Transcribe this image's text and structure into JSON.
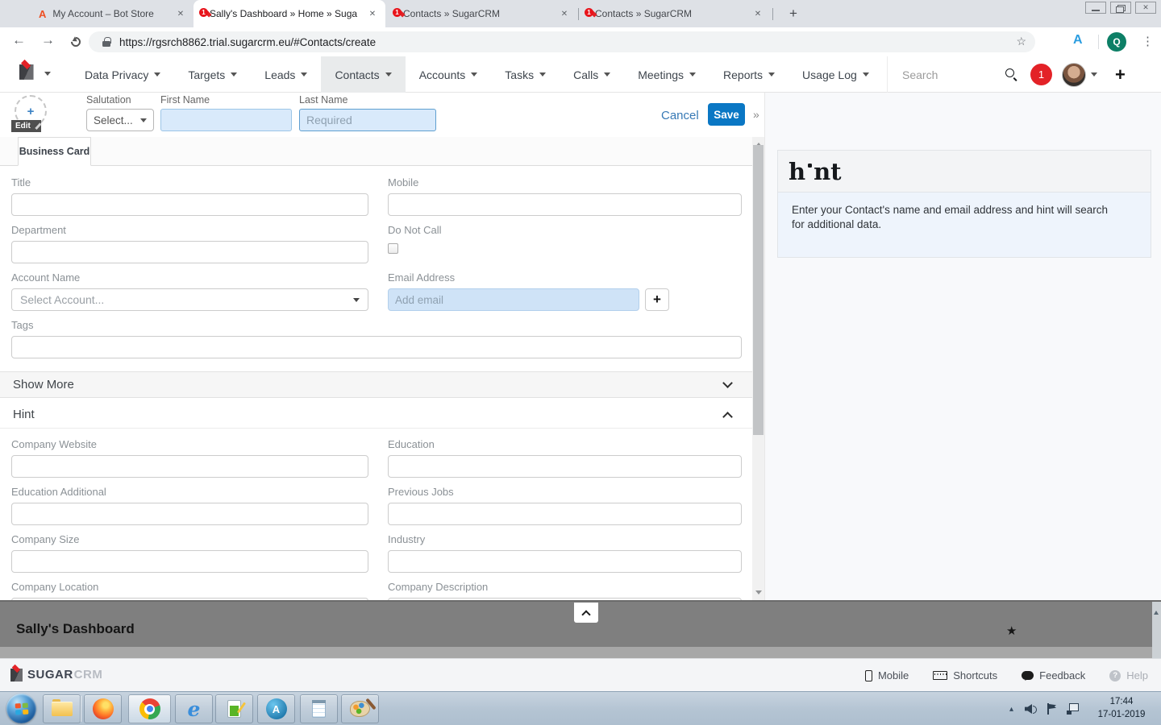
{
  "browser": {
    "tabs": [
      {
        "title": "My Account – Bot Store",
        "favicon": "automation-anywhere",
        "favicon_letter": "A"
      },
      {
        "title": "Sally's Dashboard » Home » Suga",
        "favicon": "sugarcrm"
      },
      {
        "title": "Contacts » SugarCRM",
        "favicon": "sugarcrm"
      },
      {
        "title": "Contacts » SugarCRM",
        "favicon": "sugarcrm"
      }
    ],
    "favicon_badge": "1",
    "url": "https://rgsrch8862.trial.sugarcrm.eu/#Contacts/create",
    "extension_letter": "A",
    "profile_initial": "Q"
  },
  "icons": {
    "close": "✕",
    "new_tab": "+",
    "back": "←",
    "forward": "→",
    "star_outline": "☆",
    "star_filled": "★",
    "menu_dots": "⋮",
    "overflow_chevrons": "»",
    "plus": "+",
    "question": "?",
    "tray_arrow": "▴",
    "ie_letter": "e",
    "aa_letter": "A"
  },
  "navbar": {
    "menu": [
      "Data Privacy",
      "Targets",
      "Leads",
      "Contacts",
      "Accounts",
      "Tasks",
      "Calls",
      "Meetings",
      "Reports",
      "Usage Log"
    ],
    "active_item": "Contacts",
    "search_placeholder": "Search",
    "notification_count": "1"
  },
  "record_header": {
    "edit_label": "Edit",
    "salutation_label": "Salutation",
    "salutation_value": "Select...",
    "first_name_label": "First Name",
    "last_name_label": "Last Name",
    "last_name_placeholder": "Required",
    "cancel_label": "Cancel",
    "save_label": "Save"
  },
  "form": {
    "tab_label": "Business Card",
    "title_label": "Title",
    "mobile_label": "Mobile",
    "department_label": "Department",
    "do_not_call_label": "Do Not Call",
    "account_name_label": "Account Name",
    "account_name_placeholder": "Select Account...",
    "email_label": "Email Address",
    "email_placeholder": "Add email",
    "email_add_button": "+",
    "tags_label": "Tags",
    "show_more_label": "Show More",
    "hint_section_label": "Hint",
    "hint_fields": {
      "company_website": "Company Website",
      "education": "Education",
      "education_additional": "Education Additional",
      "previous_jobs": "Previous Jobs",
      "company_size": "Company Size",
      "industry": "Industry",
      "company_location": "Company Location",
      "company_description": "Company Description"
    }
  },
  "hint_widget": {
    "logo_h": "h",
    "logo_nt": "nt",
    "description": "Enter your Contact's name and email address and hint will search for additional data."
  },
  "dashboard": {
    "title": "Sally's Dashboard"
  },
  "footer": {
    "brand_primary": "SUGAR",
    "brand_secondary": "CRM",
    "mobile_label": "Mobile",
    "shortcuts_label": "Shortcuts",
    "feedback_label": "Feedback",
    "help_label": "Help"
  },
  "taskbar": {
    "time": "17:44",
    "date": "17-01-2019"
  }
}
